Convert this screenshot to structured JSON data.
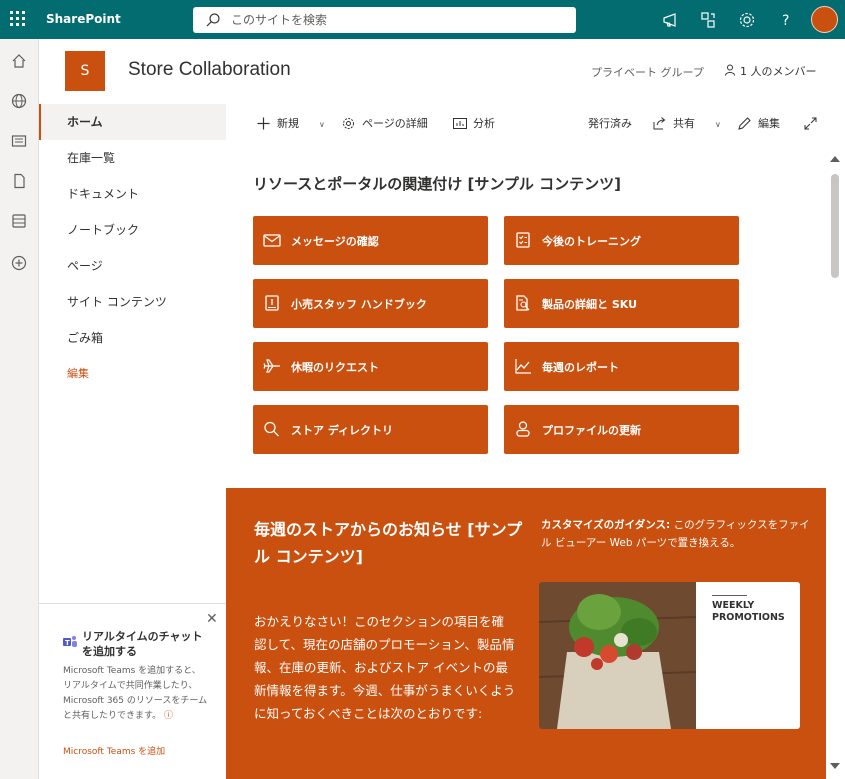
{
  "suite": {
    "app_name": "SharePoint",
    "search_placeholder": "このサイトを検索"
  },
  "site": {
    "logo_letter": "S",
    "title": "Store Collaboration",
    "privacy": "プライベート グループ",
    "members": "1 人のメンバー"
  },
  "nav": {
    "items": [
      {
        "label": "ホーム"
      },
      {
        "label": "在庫一覧"
      },
      {
        "label": "ドキュメント"
      },
      {
        "label": "ノートブック"
      },
      {
        "label": "ページ"
      },
      {
        "label": "サイト コンテンツ"
      },
      {
        "label": "ごみ箱"
      }
    ],
    "edit_label": "編集"
  },
  "teams_promo": {
    "title": "リアルタイムのチャットを追加する",
    "description": "Microsoft Teams を追加すると、リアルタイムで共同作業したり、Microsoft 365 のリソースをチームと共有したりできます。",
    "info_icon": "ⓘ",
    "link": "Microsoft Teams を追加"
  },
  "commandbar": {
    "new": "新規",
    "page_details": "ページの詳細",
    "analytics": "分析",
    "status": "発行済み",
    "share": "共有",
    "edit": "編集"
  },
  "quicklinks": {
    "title": "リソースとポータルの関連付け [サンプル コンテンツ]",
    "items": [
      {
        "label": "メッセージの確認",
        "icon": "mail-icon"
      },
      {
        "label": "今後のトレーニング",
        "icon": "checklist-icon"
      },
      {
        "label": "小売スタッフ ハンドブック",
        "icon": "book-icon"
      },
      {
        "label": "製品の詳細と SKU",
        "icon": "document-search-icon"
      },
      {
        "label": "休暇のリクエスト",
        "icon": "airplane-icon"
      },
      {
        "label": "毎週のレポート",
        "icon": "chart-line-icon"
      },
      {
        "label": "ストア ディレクトリ",
        "icon": "search-icon"
      },
      {
        "label": "プロファイルの更新",
        "icon": "person-icon"
      }
    ]
  },
  "news": {
    "title": "毎週のストアからのお知らせ [サンプル コンテンツ]",
    "guidance_bold": "カスタマイズのガイダンス:",
    "guidance_text": " このグラフィックスをファイル ビューアー Web パーツで置き換える。",
    "body": "おかえりなさい！このセクションの項目を確認して、現在の店舗のプロモーション、製品情報、在庫の更新、およびストア イベントの最新情報を得ます。今週、仕事がうまくいくように知っておくべきことは次のとおりです:",
    "promo_line1": "WEEKLY",
    "promo_line2": "PROMOTIONS"
  },
  "colors": {
    "suite_bar": "#036c70",
    "accent": "#ca5010"
  }
}
